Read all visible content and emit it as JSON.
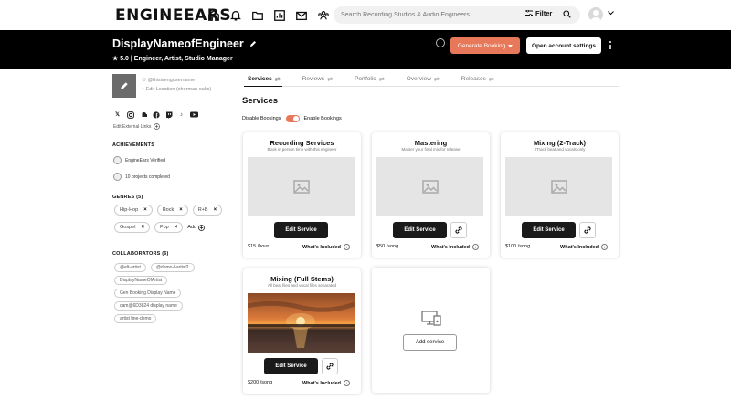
{
  "topbar": {
    "logo": "ENGINEEARS",
    "search_placeholder": "Search Recording Studios & Audio Engineers",
    "filter_label": "Filter"
  },
  "header": {
    "display_name": "DisplayNameofEngineer",
    "rating_line": "★ 5.0  |  Engineer, Artist, Studio Manager",
    "generate_booking_label": "Generate Booking",
    "open_settings_label": "Open account settings"
  },
  "sidebar": {
    "username": "@thisisengusername",
    "location": "Edit Location (sherman oaks)",
    "edit_links": "Edit External Links",
    "achievements_title": "ACHIEVEMENTS",
    "achievements": [
      "EngineEars Verified",
      "10 projects completed"
    ],
    "genres_title": "GENRES (5)",
    "genres": [
      "Hip-Hop",
      "Rock",
      "R+B",
      "Gospel",
      "Pop"
    ],
    "add_label": "Add",
    "collaborators_title": "COLLABORATORS (6)",
    "collaborators": [
      "@elt-artist",
      "@demo-l-artist2",
      "DisplayNameOfArtist",
      "Gen Booking Display Name",
      "cam@6D3824 display name",
      "artist fine-demo"
    ]
  },
  "tabs": [
    {
      "label": "Services"
    },
    {
      "label": "Reviews"
    },
    {
      "label": "Portfolio"
    },
    {
      "label": "Overview"
    },
    {
      "label": "Releases"
    }
  ],
  "services": {
    "title": "Services",
    "disable_label": "Disable Bookings",
    "enable_label": "Enable Bookings",
    "edit_label": "Edit Service",
    "included_label": "What's Included",
    "add_service_label": "Add service",
    "cards": [
      {
        "title": "Recording Services",
        "subtitle": "Book in person time with this engineer",
        "price": "$15 /hour"
      },
      {
        "title": "Mastering",
        "subtitle": "Master your final mix for release",
        "price": "$50 /song"
      },
      {
        "title": "Mixing (2-Track)",
        "subtitle": "2Track beat and vocals only",
        "price": "$100 /song"
      },
      {
        "title": "Mixing (Full Stems)",
        "subtitle": "All beat files and vocal files separated",
        "price": "$200 /song"
      }
    ]
  },
  "colors": {
    "accent": "#e8785a",
    "header_bg": "#000000"
  }
}
